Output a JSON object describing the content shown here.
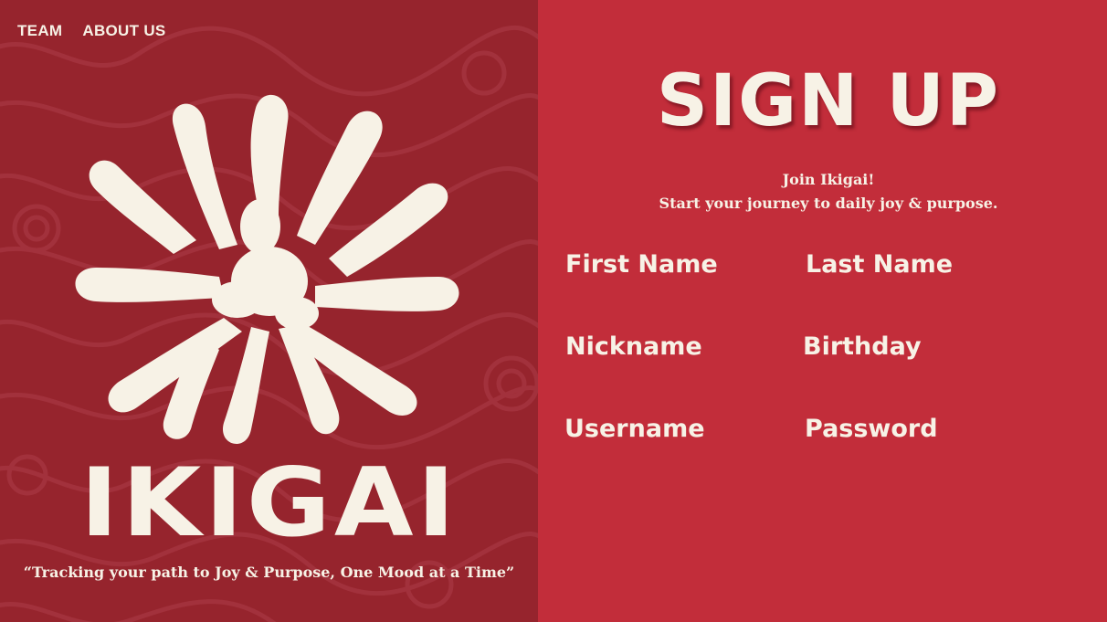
{
  "nav": {
    "team_label": "TEAM",
    "about_label": "ABOUT US"
  },
  "brand": {
    "wordmark": "IKIGAI",
    "tagline": "“Tracking your path to Joy & Purpose, One Mood at a Time”",
    "logo_icon": "ikigai-leaf-emblem-icon"
  },
  "signup": {
    "title": "SIGN UP",
    "subtitle_line1": "Join Ikigai!",
    "subtitle_line2": "Start your journey to daily joy & purpose.",
    "fields": {
      "first_name": "First Name",
      "last_name": "Last Name",
      "nickname": "Nickname",
      "birthday": "Birthday",
      "username": "Username",
      "password": "Password"
    }
  },
  "colors": {
    "left_panel": "#96242d",
    "right_panel": "#c22d3a",
    "cream": "#f7f2e6"
  }
}
